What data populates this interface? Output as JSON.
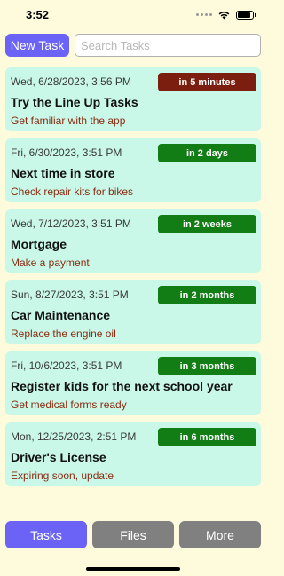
{
  "status_bar": {
    "time": "3:52"
  },
  "toolbar": {
    "new_task_label": "New Task",
    "search_placeholder": "Search Tasks",
    "search_value": ""
  },
  "colors": {
    "background": "#fdfbdc",
    "card": "#c9f7e8",
    "accent": "#6b63f6",
    "badge_soon": "#7b1d0f",
    "badge_later": "#127c15",
    "tab_inactive": "#808080",
    "note_text": "#8b2c12"
  },
  "tasks": [
    {
      "date": "Wed, 6/28/2023, 3:56 PM",
      "title": "Try the Line Up Tasks",
      "note": "Get familiar with the app",
      "due": "in 5 minutes",
      "due_color": "#7b1d0f"
    },
    {
      "date": "Fri, 6/30/2023, 3:51 PM",
      "title": "Next time in store",
      "note": "Check repair kits for bikes",
      "due": "in 2 days",
      "due_color": "#127c15"
    },
    {
      "date": "Wed, 7/12/2023, 3:51 PM",
      "title": "Mortgage",
      "note": "Make a payment",
      "due": "in 2 weeks",
      "due_color": "#127c15"
    },
    {
      "date": "Sun, 8/27/2023, 3:51 PM",
      "title": "Car Maintenance",
      "note": "Replace the engine oil",
      "due": "in 2 months",
      "due_color": "#127c15"
    },
    {
      "date": "Fri, 10/6/2023, 3:51 PM",
      "title": "Register kids for the next school year",
      "note": "Get medical forms ready",
      "due": "in 3 months",
      "due_color": "#127c15"
    },
    {
      "date": "Mon, 12/25/2023, 2:51 PM",
      "title": "Driver's License",
      "note": "Expiring soon, update",
      "due": "in 6 months",
      "due_color": "#127c15"
    }
  ],
  "tabs": [
    {
      "label": "Tasks",
      "active": true,
      "color": "#6b63f6"
    },
    {
      "label": "Files",
      "active": false,
      "color": "#808080"
    },
    {
      "label": "More",
      "active": false,
      "color": "#808080"
    }
  ]
}
